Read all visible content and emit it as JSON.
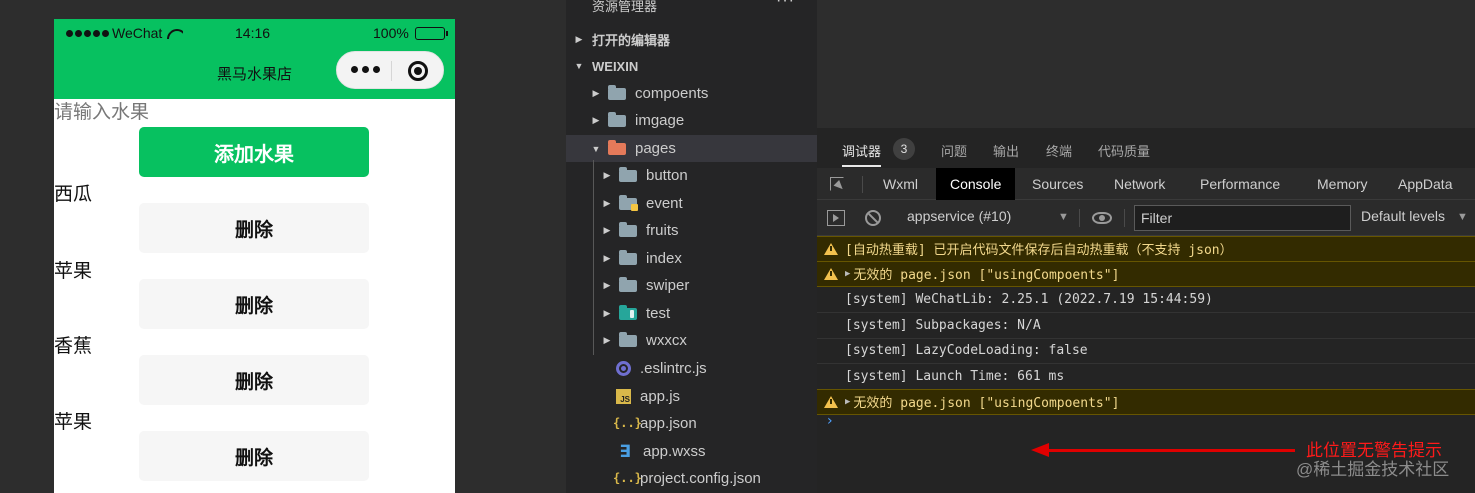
{
  "simulator": {
    "status": {
      "carrier": "WeChat",
      "time": "14:16",
      "battery": "100%",
      "battery_level": 1.0
    },
    "nav_title": "黑马水果店",
    "input_placeholder": "请输入水果",
    "add_button": "添加水果",
    "fruits": [
      {
        "name": "西瓜",
        "delete_label": "删除"
      },
      {
        "name": "苹果",
        "delete_label": "删除"
      },
      {
        "name": "香蕉",
        "delete_label": "删除"
      },
      {
        "name": "苹果",
        "delete_label": "删除"
      }
    ],
    "colors": {
      "header": "#07c160",
      "add_button": "#07c160"
    }
  },
  "explorer": {
    "title": "资源管理器",
    "more": "···",
    "sections": {
      "open_editors": "打开的编辑器",
      "workspace": "WEIXIN"
    },
    "tree": [
      {
        "label": "compoents",
        "type": "folder",
        "icon": "folder-icon"
      },
      {
        "label": "imgage",
        "type": "folder",
        "icon": "folder-icon"
      },
      {
        "label": "pages",
        "type": "folder-open",
        "icon": "folder-open-icon"
      },
      {
        "label": "button",
        "type": "folder",
        "icon": "folder-icon"
      },
      {
        "label": "event",
        "type": "folder",
        "icon": "folder-event-icon"
      },
      {
        "label": "fruits",
        "type": "folder",
        "icon": "folder-icon"
      },
      {
        "label": "index",
        "type": "folder",
        "icon": "folder-icon"
      },
      {
        "label": "swiper",
        "type": "folder",
        "icon": "folder-icon"
      },
      {
        "label": "test",
        "type": "folder",
        "icon": "folder-test-icon"
      },
      {
        "label": "wxxcx",
        "type": "folder",
        "icon": "folder-icon"
      },
      {
        "label": ".eslintrc.js",
        "type": "file",
        "icon": "eslint-icon"
      },
      {
        "label": "app.js",
        "type": "file",
        "icon": "js-icon"
      },
      {
        "label": "app.json",
        "type": "file",
        "icon": "json-icon"
      },
      {
        "label": "app.wxss",
        "type": "file",
        "icon": "css-icon"
      },
      {
        "label": "project.config.json",
        "type": "file",
        "icon": "json-icon"
      }
    ],
    "json_icon_text": "{..}",
    "js_icon_text": "JS",
    "css_icon_text": "∃"
  },
  "debugger": {
    "tabs": [
      {
        "label": "调试器"
      },
      {
        "label": "问题"
      },
      {
        "label": "输出"
      },
      {
        "label": "终端"
      },
      {
        "label": "代码质量"
      }
    ],
    "badge": "3",
    "devtools_tabs": [
      "Wxml",
      "Console",
      "Sources",
      "Network",
      "Performance",
      "Memory",
      "AppData"
    ],
    "context": "appservice (#10)",
    "filter_placeholder": "Filter",
    "levels": "Default levels",
    "logs": [
      {
        "level": "warn",
        "text": "[自动热重载] 已开启代码文件保存后自动热重载（不支持 json）"
      },
      {
        "level": "warn",
        "expandable": true,
        "text": "无效的 page.json [\"usingCompoents\"]"
      },
      {
        "level": "info",
        "text": "[system] WeChatLib: 2.25.1 (2022.7.19 15:44:59)"
      },
      {
        "level": "info",
        "text": "[system] Subpackages: N/A"
      },
      {
        "level": "info",
        "text": "[system] LazyCodeLoading: false"
      },
      {
        "level": "info",
        "text": "[system] Launch Time: 661 ms"
      },
      {
        "level": "warn",
        "expandable": true,
        "text": "无效的 page.json [\"usingCompoents\"]"
      }
    ],
    "prompt": "›"
  },
  "annotation": {
    "text": "此位置无警告提示",
    "color": "#e00000"
  },
  "watermark": "@稀土掘金技术社区"
}
